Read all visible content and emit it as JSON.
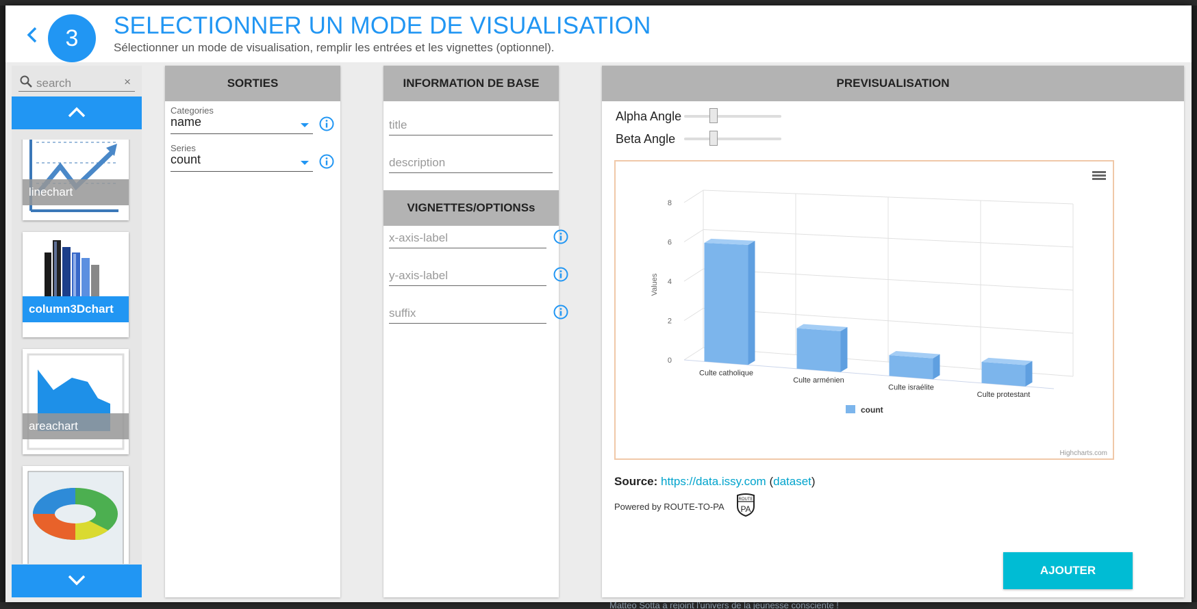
{
  "header": {
    "step": "3",
    "title": "SELECTIONNER UN MODE DE VISUALISATION",
    "subtitle": "Sélectionner un mode de visualisation, remplir les entrées et les vignettes (optionnel)."
  },
  "picker": {
    "search_placeholder": "search",
    "clear": "×",
    "items": [
      {
        "label": "linechart",
        "selected": false
      },
      {
        "label": "column3Dchart",
        "selected": true
      },
      {
        "label": "areachart",
        "selected": false
      },
      {
        "label": "",
        "selected": false
      }
    ]
  },
  "sorties": {
    "heading": "SORTIES",
    "categories_label": "Categories",
    "categories_value": "name",
    "series_label": "Series",
    "series_value": "count"
  },
  "info_base": {
    "heading": "INFORMATION DE BASE",
    "title_placeholder": "title",
    "description_placeholder": "description"
  },
  "vignettes": {
    "heading": "VIGNETTES/OPTIONSs",
    "x_axis_placeholder": "x-axis-label",
    "y_axis_placeholder": "y-axis-label",
    "suffix_placeholder": "suffix"
  },
  "preview": {
    "heading": "PREVISUALISATION",
    "alpha_label": "Alpha Angle",
    "beta_label": "Beta Angle",
    "alpha_value": 0.3,
    "beta_value": 0.3,
    "credits": "Highcharts.com",
    "source_label": "Source:",
    "source_link": "https://data.issy.com",
    "source_paren_open": " (",
    "dataset_link": "dataset",
    "source_paren_close": ")",
    "powered": "Powered by ROUTE-TO-PA",
    "badge_top": "ROUTE",
    "badge_main": "PA",
    "add_button": "AJOUTER"
  },
  "chart_data": {
    "type": "bar",
    "categories": [
      "Culte catholique",
      "Culte arménien",
      "Culte israélite",
      "Culte protestant"
    ],
    "series": [
      {
        "name": "count",
        "values": [
          6,
          2,
          1,
          1
        ],
        "color": "#7cb5ec"
      }
    ],
    "ylabel": "Values",
    "ylim": [
      0,
      8
    ],
    "yticks": [
      "0",
      "2",
      "4",
      "6",
      "8"
    ],
    "legend": "bottom-center",
    "grid": true
  },
  "colors": {
    "accent": "#2196f3",
    "button": "#00bcd4",
    "panel_header": "#b3b3b3"
  },
  "footer_text": "Matteo Sotta a rejoint l'univers de la jeunesse consciente !"
}
